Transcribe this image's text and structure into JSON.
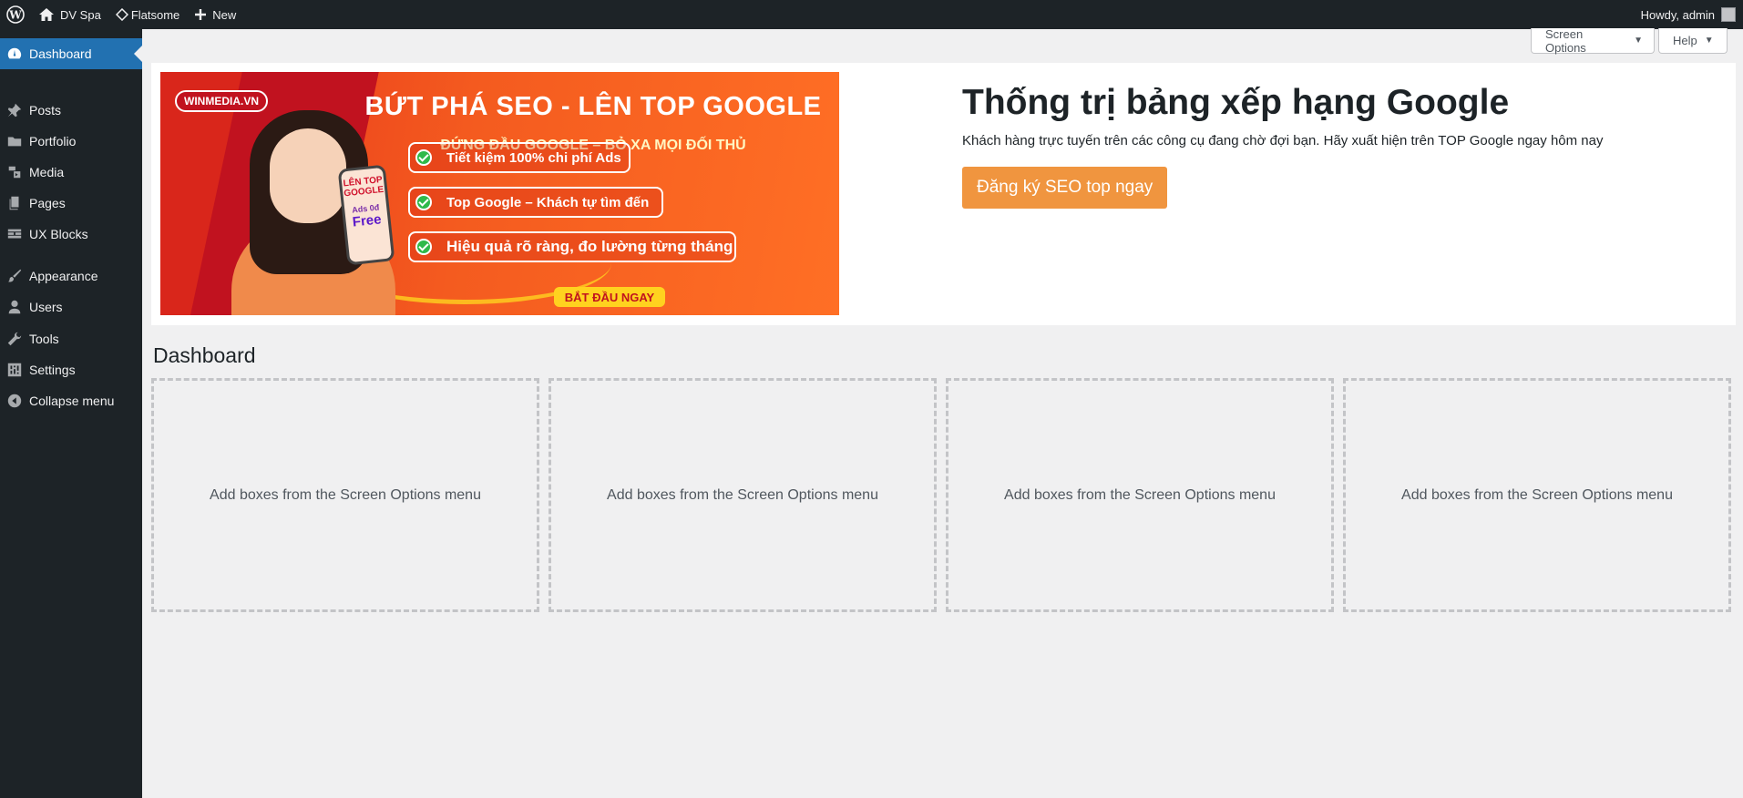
{
  "adminbar": {
    "site_name": "DV Spa",
    "theme_label": "Flatsome",
    "new_label": "New",
    "howdy": "Howdy, admin"
  },
  "sidebar": {
    "items": [
      {
        "label": "Dashboard",
        "icon": "dashboard-icon",
        "current": true
      },
      {
        "label": "Posts",
        "icon": "pin-icon"
      },
      {
        "label": "Portfolio",
        "icon": "folder-icon"
      },
      {
        "label": "Media",
        "icon": "media-icon"
      },
      {
        "label": "Pages",
        "icon": "pages-icon"
      },
      {
        "label": "UX Blocks",
        "icon": "blocks-icon"
      },
      {
        "label": "Appearance",
        "icon": "brush-icon"
      },
      {
        "label": "Users",
        "icon": "user-icon"
      },
      {
        "label": "Tools",
        "icon": "wrench-icon"
      },
      {
        "label": "Settings",
        "icon": "settings-icon"
      },
      {
        "label": "Collapse menu",
        "icon": "collapse-icon"
      }
    ]
  },
  "screen_meta": {
    "screen_options": "Screen Options",
    "help": "Help"
  },
  "promo": {
    "banner": {
      "badge": "WINMEDIA.VN",
      "title": "BỨT PHÁ SEO - LÊN TOP GOOGLE",
      "subtitle": "ĐỨNG ĐẦU GOOGLE – BỎ XA MỌI ĐỐI THỦ",
      "points": [
        "Tiết kiệm 100% chi phí Ads",
        "Top Google – Khách tự tìm đến",
        "Hiệu quả rõ ràng, đo lường từng tháng"
      ],
      "cta": "BẮT ĐẦU NGAY",
      "phone_line1": "LÊN TOP GOOGLE",
      "phone_line2": "Ads 0đ",
      "phone_line3": "Free"
    },
    "title": "Thống trị bảng xếp hạng Google",
    "text": "Khách hàng trực tuyến trên các công cụ đang chờ đợi bạn. Hãy xuất hiện trên TOP Google ngay hôm nay",
    "button": "Đăng ký SEO top ngay"
  },
  "dashboard": {
    "title": "Dashboard",
    "empty_box_text": "Add boxes from the Screen Options menu"
  }
}
